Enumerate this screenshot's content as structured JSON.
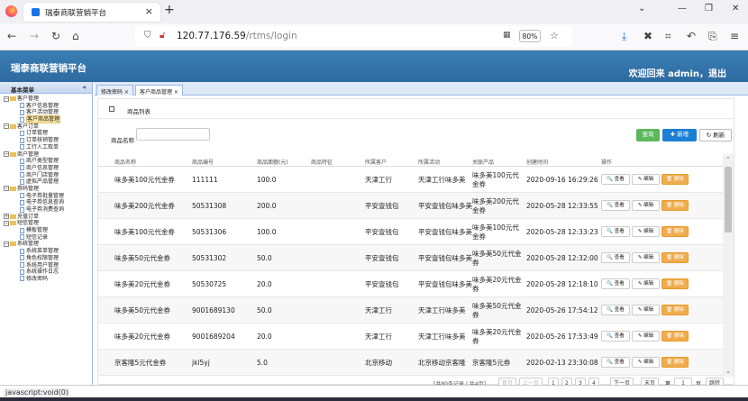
{
  "browser": {
    "tab_title": "瑞泰商联营销平台",
    "url_host": "120.77.176.59",
    "url_path": "/rtms/login",
    "zoom": "80%",
    "status_text": "javascript:void(0)"
  },
  "app": {
    "title": "瑞泰商联营销平台",
    "welcome": "欢迎回来 admin，退出"
  },
  "sidebar": {
    "header": "基本菜单",
    "groups": [
      {
        "label": "客户管理",
        "items": [
          "客户信息管理",
          "客户活动管理",
          "客户商品管理"
        ]
      },
      {
        "label": "客户订单",
        "items": [
          "订单管理",
          "订单核销管理",
          "工行人工取单"
        ]
      },
      {
        "label": "商户管理",
        "items": [
          "商户类型管理",
          "商户信息管理",
          "商户门店管理",
          "虚拟产品管理"
        ]
      },
      {
        "label": "券码管理",
        "items": [
          "电子券批量管理",
          "电子券信息查询",
          "电子券消费查询"
        ]
      },
      {
        "label": "充值订单",
        "items": []
      },
      {
        "label": "短信管理",
        "items": [
          "模板管理",
          "短信记录"
        ]
      },
      {
        "label": "系统管理",
        "items": [
          "系统菜单管理",
          "角色权限管理",
          "系统用户管理",
          "系统操作日志",
          "修改密码"
        ]
      }
    ]
  },
  "page_tabs": [
    "修改密码 ×",
    "客户商品管理 ×"
  ],
  "card": {
    "title": "商品列表",
    "search_label": "商品名称",
    "btn_green": "查询",
    "btn_add": "✚ 新增",
    "btn_refresh": "↻ 刷新"
  },
  "table": {
    "headers": [
      "商品名称",
      "商品编号",
      "商品面额(元)",
      "商品特征",
      "所属客户",
      "所属活动",
      "关联产品",
      "创建时间",
      "操作"
    ],
    "actions": {
      "view": "🔍 查看",
      "edit": "✎ 编辑",
      "del": "🗑 删除"
    },
    "rows": [
      {
        "name": "味多美100元代金券",
        "code": "111111",
        "amount": "100.0",
        "customer": "天津工行",
        "activity": "天津工行味多美",
        "product": "味多美100元代金券",
        "created": "2020-09-16 16:29:26"
      },
      {
        "name": "味多美200元代金券",
        "code": "50531308",
        "amount": "200.0",
        "customer": "平安壹钱包",
        "activity": "平安壹钱包味多美",
        "product": "味多美200元代金券",
        "created": "2020-05-28 12:33:55"
      },
      {
        "name": "味多美100元代金券",
        "code": "50531306",
        "amount": "100.0",
        "customer": "平安壹钱包",
        "activity": "平安壹钱包味多美",
        "product": "味多美100元代金券",
        "created": "2020-05-28 12:33:23"
      },
      {
        "name": "味多美50元代金券",
        "code": "50531302",
        "amount": "50.0",
        "customer": "平安壹钱包",
        "activity": "平安壹钱包味多美",
        "product": "味多美50元代金券",
        "created": "2020-05-28 12:32:00"
      },
      {
        "name": "味多美20元代金券",
        "code": "50530725",
        "amount": "20.0",
        "customer": "平安壹钱包",
        "activity": "平安壹钱包味多美",
        "product": "味多美20元代金券",
        "created": "2020-05-28 12:18:10"
      },
      {
        "name": "味多美50元代金券",
        "code": "9001689130",
        "amount": "50.0",
        "customer": "天津工行",
        "activity": "天津工行味多美",
        "product": "味多美50元代金券",
        "created": "2020-05-26 17:54:12"
      },
      {
        "name": "味多美20元代金券",
        "code": "9001689204",
        "amount": "20.0",
        "customer": "天津工行",
        "activity": "天津工行味多美",
        "product": "味多美20元代金券",
        "created": "2020-05-26 17:53:49"
      },
      {
        "name": "京客隆5元代金券",
        "code": "jkl5yj",
        "amount": "5.0",
        "customer": "北京移动",
        "activity": "北京移动京客隆",
        "product": "京客隆5元券",
        "created": "2020-02-13 23:30:08"
      }
    ]
  },
  "pager": {
    "summary": "[共80条记录 | 共4页]",
    "first": "首页",
    "prev": "上一页",
    "pages": [
      "1",
      "2",
      "3",
      "4"
    ],
    "next": "下一页",
    "last": "末页",
    "goto_label": "第",
    "goto_value": "1",
    "goto_unit": "页",
    "jump": "跳转"
  }
}
